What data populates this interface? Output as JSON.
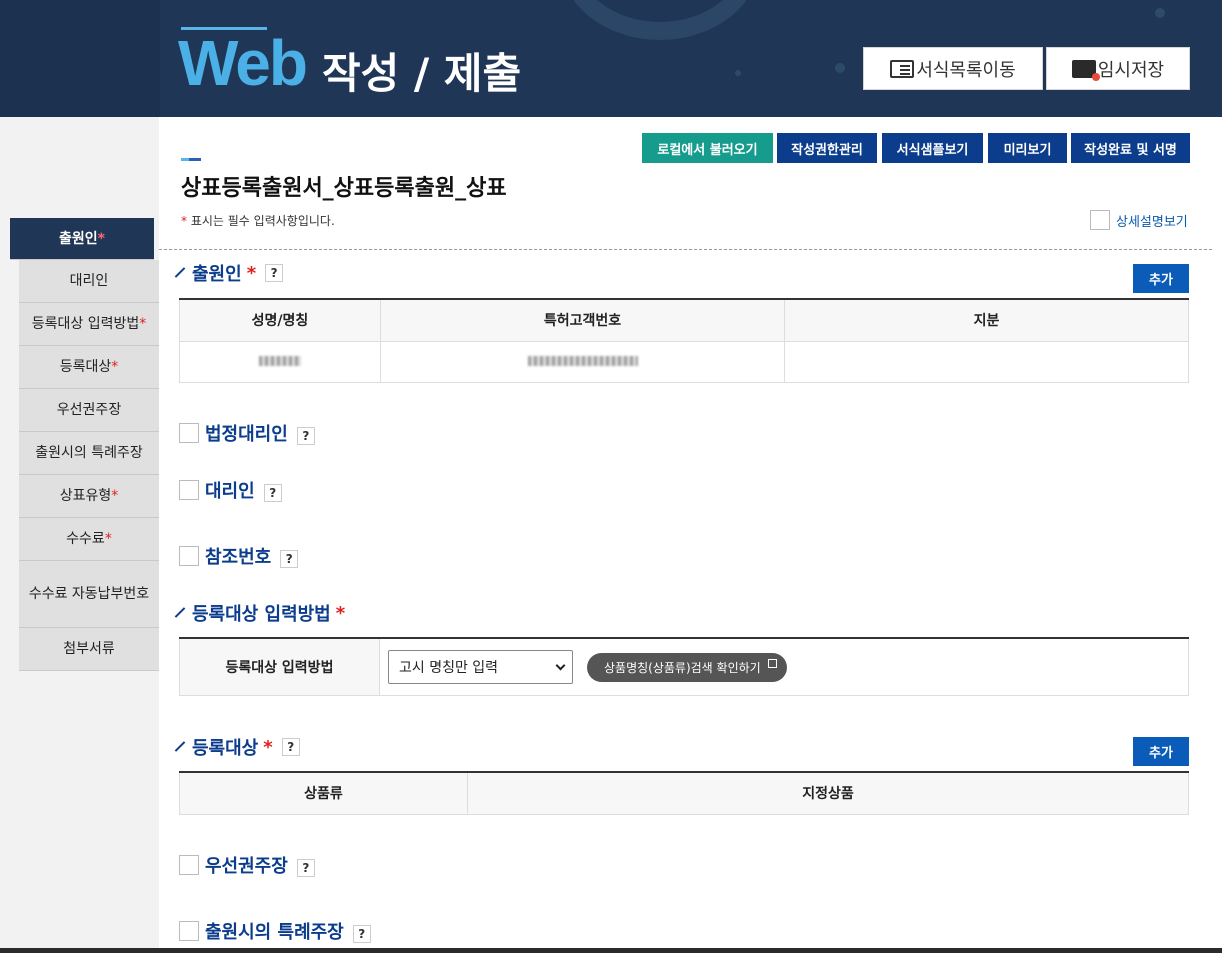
{
  "header": {
    "title_web": "Web",
    "title_rest": "작성 / 제출",
    "btn_form_list": "서식목록이동",
    "btn_temp_save": "임시저장"
  },
  "actions": {
    "load_local": "로컬에서 불러오기",
    "auth_manage": "작성권한관리",
    "sample_view": "서식샘플보기",
    "preview": "미리보기",
    "complete_sign": "작성완료 및 서명"
  },
  "page": {
    "title": "상표등록출원서_상표등록출원_상표",
    "req_mark": "*",
    "req_note": "표시는 필수 입력사항입니다.",
    "detail_view": "상세설명보기"
  },
  "sidebar": {
    "items": [
      {
        "label": "출원인",
        "req": "*"
      },
      {
        "label": "대리인",
        "req": ""
      },
      {
        "label": "등록대상 입력방법",
        "req": "*"
      },
      {
        "label": "등록대상",
        "req": "*"
      },
      {
        "label": "우선권주장",
        "req": ""
      },
      {
        "label": "출원시의 특례주장",
        "req": ""
      },
      {
        "label": "상표유형",
        "req": "*"
      },
      {
        "label": "수수료",
        "req": "*"
      },
      {
        "label": "수수료 자동납부번호",
        "req": ""
      },
      {
        "label": "첨부서류",
        "req": ""
      }
    ]
  },
  "sections": {
    "applicant": {
      "title": "출원인",
      "req": "*",
      "help": "?",
      "add": "추가",
      "headers": [
        "성명/명칭",
        "특허고객번호",
        "지분"
      ]
    },
    "legal_agent": {
      "title": "법정대리인",
      "help": "?"
    },
    "agent": {
      "title": "대리인",
      "help": "?"
    },
    "reference": {
      "title": "참조번호",
      "help": "?"
    },
    "input_method": {
      "title": "등록대상 입력방법",
      "req": "*",
      "label": "등록대상 입력방법",
      "selected": "고시 명칭만 입력",
      "search_btn": "상품명칭(상품류)검색 확인하기"
    },
    "target": {
      "title": "등록대상",
      "req": "*",
      "help": "?",
      "add": "추가",
      "headers": [
        "상품류",
        "지정상품"
      ]
    },
    "priority": {
      "title": "우선권주장",
      "help": "?"
    },
    "special": {
      "title": "출원시의 특례주장",
      "help": "?"
    }
  }
}
